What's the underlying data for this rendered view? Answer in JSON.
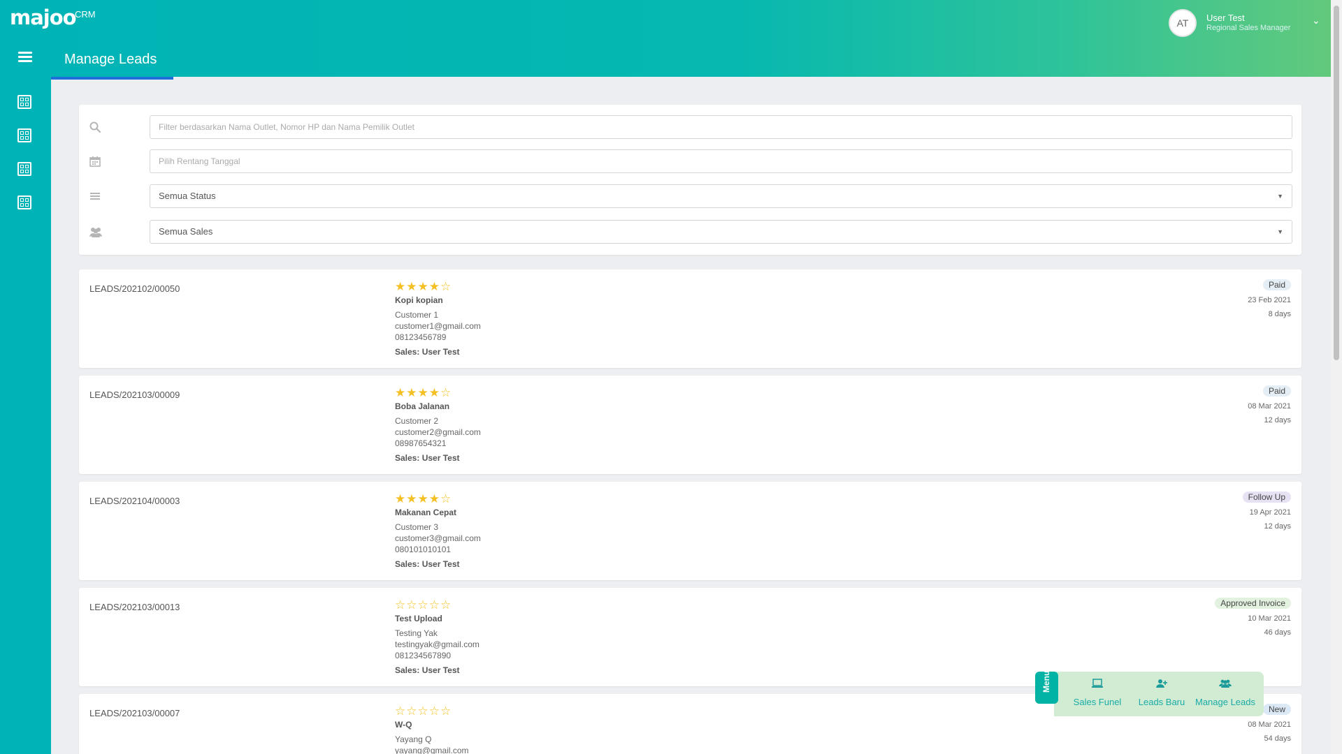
{
  "header": {
    "logo": "majoo",
    "logo_suffix": "CRM",
    "user": {
      "initials": "AT",
      "name": "User Test",
      "role": "Regional Sales Manager"
    },
    "page_title": "Manage Leads"
  },
  "colors": {
    "brand_teal": "#00b3b6",
    "gradient_end": "#62c97c",
    "star": "#f5c023",
    "active_tab_underline": "#1e6fd9"
  },
  "sidebar": {
    "items": [
      {
        "icon": "dashboard-grid-icon"
      },
      {
        "icon": "dashboard-grid-icon"
      },
      {
        "icon": "dashboard-grid-icon"
      },
      {
        "icon": "dashboard-grid-icon"
      }
    ]
  },
  "filters": {
    "search_placeholder": "Filter berdasarkan Nama Outlet, Nomor HP dan Nama Pemilik Outlet",
    "date_placeholder": "Pilih Rentang Tanggal",
    "status_value": "Semua Status",
    "sales_value": "Semua Sales"
  },
  "leads": [
    {
      "id": "LEADS/202102/00050",
      "rating": 4,
      "stars": "★★★★☆",
      "outlet": "Kopi kopian",
      "customer": "Customer 1",
      "email": "customer1@gmail.com",
      "phone": "08123456789",
      "sales": "Sales: User Test",
      "status": "Paid",
      "date": "23 Feb 2021",
      "age": "8 days"
    },
    {
      "id": "LEADS/202103/00009",
      "rating": 4,
      "stars": "★★★★☆",
      "outlet": "Boba Jalanan",
      "customer": "Customer 2",
      "email": "customer2@gmail.com",
      "phone": "08987654321",
      "sales": "Sales: User Test",
      "status": "Paid",
      "date": "08 Mar 2021",
      "age": "12 days"
    },
    {
      "id": "LEADS/202104/00003",
      "rating": 4,
      "stars": "★★★★☆",
      "outlet": "Makanan Cepat",
      "customer": "Customer 3",
      "email": "customer3@gmail.com",
      "phone": "080101010101",
      "sales": "Sales: User Test",
      "status": "Follow Up",
      "date": "19 Apr 2021",
      "age": "12 days"
    },
    {
      "id": "LEADS/202103/00013",
      "rating": 0,
      "stars": "☆☆☆☆☆",
      "outlet": "Test Upload",
      "customer": "Testing Yak",
      "email": "testingyak@gmail.com",
      "phone": "081234567890",
      "sales": "Sales: User Test",
      "status": "Approved Invoice",
      "date": "10 Mar 2021",
      "age": "46 days"
    },
    {
      "id": "LEADS/202103/00007",
      "rating": 0,
      "stars": "☆☆☆☆☆",
      "outlet": "W-Q",
      "customer": "Yayang Q",
      "email": "yayang@gmail.com",
      "phone": "",
      "sales": "",
      "status": "New",
      "date": "08 Mar 2021",
      "age": "54 days"
    }
  ],
  "quick_menu": {
    "tab_label": "Menu",
    "items": [
      {
        "label": "Sales Funel",
        "icon": "laptop-icon"
      },
      {
        "label": "Leads Baru",
        "icon": "user-plus-icon"
      },
      {
        "label": "Manage Leads",
        "icon": "users-icon"
      }
    ]
  }
}
